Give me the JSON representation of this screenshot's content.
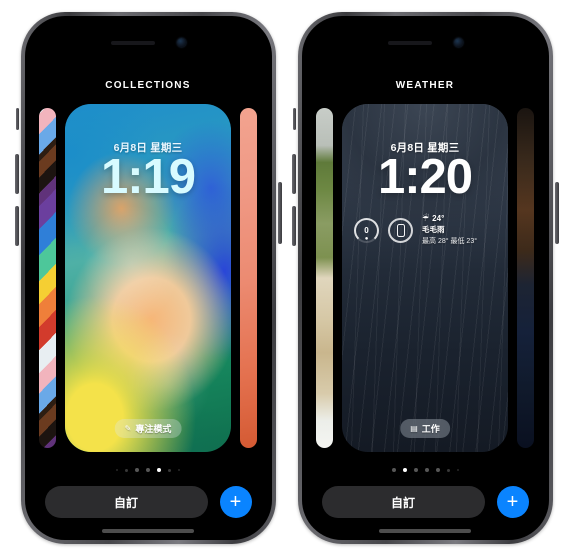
{
  "app": {
    "context": "ios-lock-screen-wallpaper-gallery",
    "accent_color": "#0a84ff",
    "button_bg": "#2c2c2e"
  },
  "phones": [
    {
      "id": "phone-left",
      "page_title": "COLLECTIONS",
      "lock_screen": {
        "date": "6月8日 星期三",
        "time": "1:19",
        "time_color": "#d8fbff",
        "focus_pill": {
          "label": "專注模式",
          "glyph": "✎"
        },
        "widgets": []
      },
      "wallpaper": {
        "name": "abstract-ios16",
        "style_class": "wp-abstract"
      },
      "side_previews": [
        {
          "name": "pride-stripes",
          "style_class": "wp-pride"
        },
        {
          "name": "salmon-gradient",
          "style_class": "wp-salmon"
        }
      ],
      "page_dots": {
        "count": 7,
        "active_index": 4
      },
      "bottom": {
        "customize_label": "自訂",
        "add_label": "+"
      }
    },
    {
      "id": "phone-right",
      "page_title": "WEATHER",
      "lock_screen": {
        "date": "6月8日 星期三",
        "time": "1:20",
        "time_color": "#ffffff",
        "focus_pill": {
          "label": "工作",
          "glyph": "▤"
        },
        "widgets": [
          {
            "name": "air-quality-gauge",
            "type": "ring",
            "value": "0"
          },
          {
            "name": "battery-phone",
            "type": "device"
          },
          {
            "name": "weather-summary",
            "type": "weather",
            "icon": "☔",
            "temperature": "24°",
            "condition": "毛毛雨",
            "high_low": "最高 28° 最低 23°"
          }
        ]
      },
      "wallpaper": {
        "name": "rainy-dark-photo",
        "style_class": "wp-rain"
      },
      "side_previews": [
        {
          "name": "green-field-photo",
          "style_class": "wp-field"
        },
        {
          "name": "dark-portrait-photo",
          "style_class": "wp-portrait"
        }
      ],
      "page_dots": {
        "count": 7,
        "active_index": 1
      },
      "bottom": {
        "customize_label": "自訂",
        "add_label": "+"
      }
    }
  ]
}
